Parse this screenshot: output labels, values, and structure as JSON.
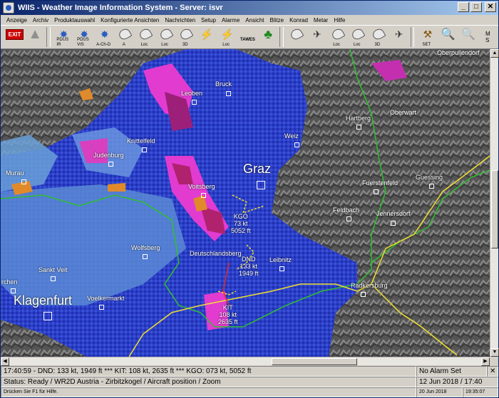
{
  "window": {
    "title": "WIIS - Weather Image Information System - Server: isvr",
    "buttons": [
      "_",
      "□",
      "✕"
    ]
  },
  "menu": [
    "Anzeige",
    "Archiv",
    "Produktauswahl",
    "Konfigurierte Ansichten",
    "Nachrichten",
    "Setup",
    "Alarme",
    "Ansicht",
    "Blitze",
    "Konrad",
    "Metar",
    "Hilfe"
  ],
  "toolbar": {
    "exit_label": "EXIT",
    "tools": [
      {
        "name": "pdusir",
        "caption": "PDUS\nIR"
      },
      {
        "name": "pdusvis",
        "caption": "PDUS\nVIS"
      },
      {
        "name": "ach",
        "caption": "A-Ch-D"
      },
      {
        "name": "a",
        "caption": "A"
      },
      {
        "name": "loc1",
        "caption": "Loc"
      },
      {
        "name": "loc2",
        "caption": "Loc"
      },
      {
        "name": "3d",
        "caption": "3D"
      },
      {
        "name": "lightning",
        "caption": ""
      },
      {
        "name": "lightning-loc",
        "caption": "Loc"
      },
      {
        "name": "tawes",
        "caption": "TAWES"
      },
      {
        "name": "tree",
        "caption": ""
      },
      {
        "name": "dish1",
        "caption": ""
      },
      {
        "name": "plane1",
        "caption": ""
      },
      {
        "name": "dish-loc",
        "caption": "Loc"
      },
      {
        "name": "dish-loc2",
        "caption": "Loc"
      },
      {
        "name": "dish-3d",
        "caption": "3D"
      },
      {
        "name": "plane2",
        "caption": ""
      },
      {
        "name": "set",
        "caption": "SET"
      },
      {
        "name": "zoom-in",
        "caption": ""
      },
      {
        "name": "zoom-out",
        "caption": ""
      },
      {
        "name": "ms",
        "caption": "M\nS"
      }
    ]
  },
  "map": {
    "cities": [
      {
        "name": "Oberpullendorf"
      },
      {
        "name": "Leoben"
      },
      {
        "name": "Bruck"
      },
      {
        "name": "Oberwart"
      },
      {
        "name": "Hartberg"
      },
      {
        "name": "Knittelfeld"
      },
      {
        "name": "Weiz"
      },
      {
        "name": "Judenburg"
      },
      {
        "name": "Graz"
      },
      {
        "name": "Guessing"
      },
      {
        "name": "Murau"
      },
      {
        "name": "Voitsberg"
      },
      {
        "name": "Fuerstenfeld"
      },
      {
        "name": "Feldbach"
      },
      {
        "name": "Jennersdorf"
      },
      {
        "name": "Wolfsberg"
      },
      {
        "name": "Deutschlandsberg"
      },
      {
        "name": "Leibnitz"
      },
      {
        "name": "Sankt Veit"
      },
      {
        "name": "rchen"
      },
      {
        "name": "Radkersburg"
      },
      {
        "name": "Klagenfurt"
      },
      {
        "name": "Voelkermarkt"
      }
    ],
    "aircraft": [
      {
        "id": "KGO",
        "speed": "73 kt",
        "alt": "5052 ft"
      },
      {
        "id": "DND",
        "speed": "133 kt",
        "alt": "1949 ft"
      },
      {
        "id": "KIT",
        "speed": "108 kt",
        "alt": "2635 ft"
      }
    ]
  },
  "status": {
    "line1": "17:40:59 - DND: 133 kt, 1949 ft *** KIT: 108 kt, 2635 ft *** KGO: 073 kt, 5052 ft",
    "alarm": "No Alarm Set",
    "line2": "Status: Ready / WR2D Austria - Zirbitzkogel / Aircraft position / Zoom",
    "date": "12 Jun 2018 / 17:40",
    "line3": "Drücken Sie F1 für Hilfe.",
    "date_small": "20 Jun 2018",
    "time_small": "19:35:07"
  }
}
